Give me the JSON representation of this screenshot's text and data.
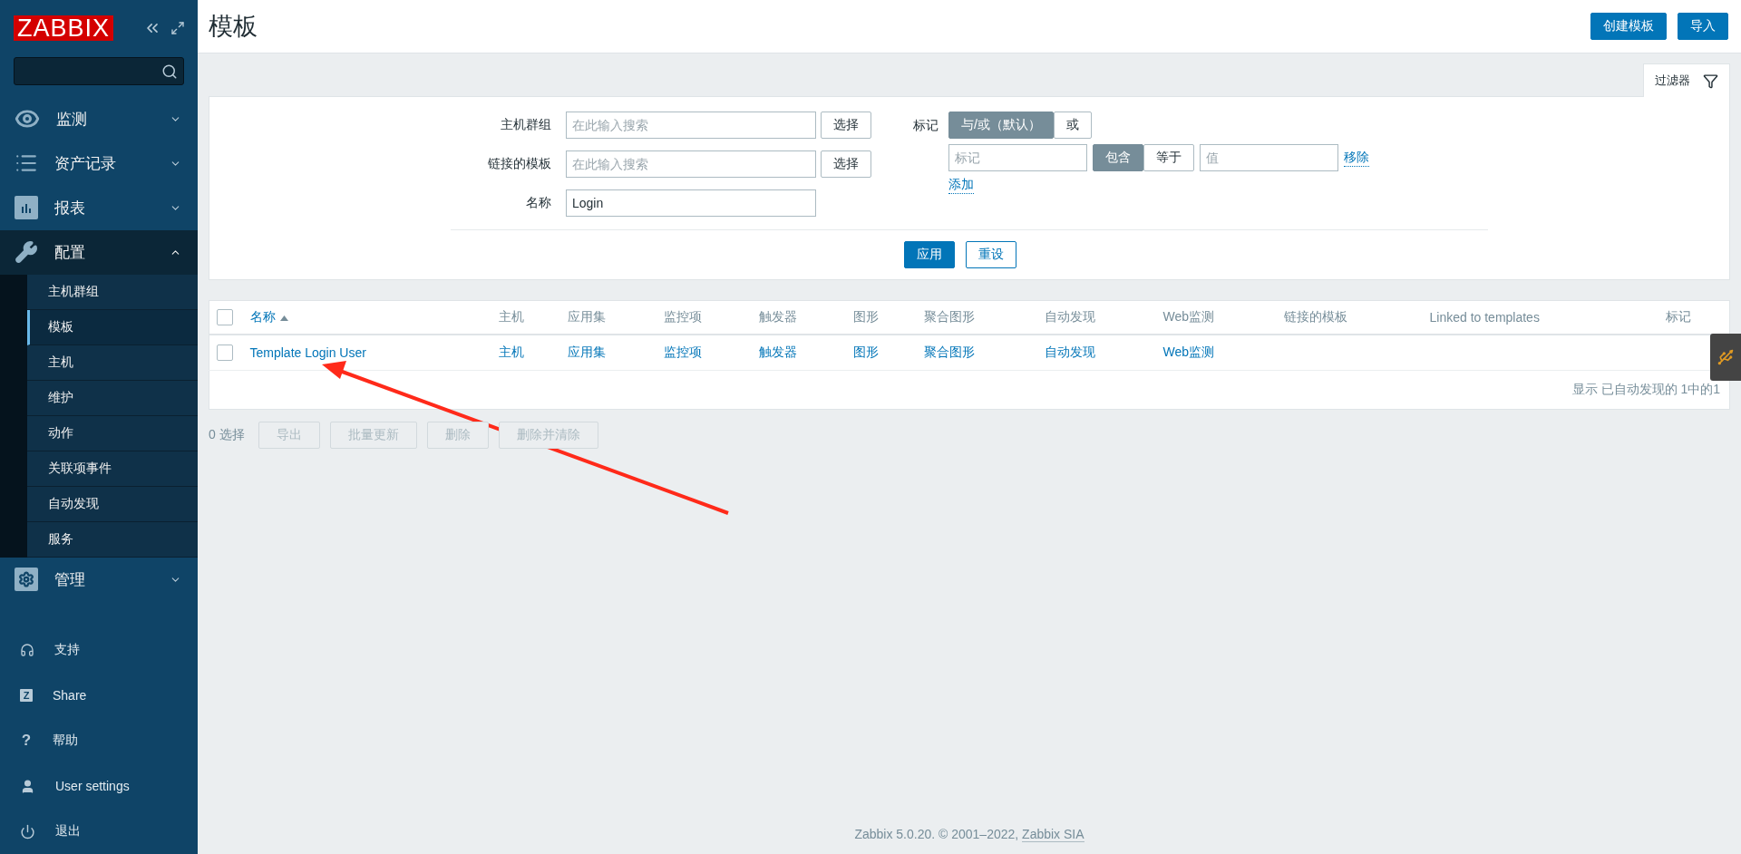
{
  "sidebar": {
    "logo": "ZABBIX",
    "menu": [
      {
        "label": "监测",
        "expanded": false
      },
      {
        "label": "资产记录",
        "expanded": false
      },
      {
        "label": "报表",
        "expanded": false
      },
      {
        "label": "配置",
        "expanded": true,
        "children": [
          {
            "label": "主机群组",
            "selected": false
          },
          {
            "label": "模板",
            "selected": true
          },
          {
            "label": "主机",
            "selected": false
          },
          {
            "label": "维护",
            "selected": false
          },
          {
            "label": "动作",
            "selected": false
          },
          {
            "label": "关联项事件",
            "selected": false
          },
          {
            "label": "自动发现",
            "selected": false
          },
          {
            "label": "服务",
            "selected": false
          }
        ]
      },
      {
        "label": "管理",
        "expanded": false
      }
    ],
    "links": [
      {
        "label": "支持"
      },
      {
        "label": "Share",
        "glyph": "Z"
      },
      {
        "label": "帮助",
        "glyph": "?"
      },
      {
        "label": "User settings"
      },
      {
        "label": "退出"
      }
    ]
  },
  "header": {
    "title": "模板",
    "buttons": [
      "创建模板",
      "导入"
    ]
  },
  "filter": {
    "tab": "过滤器",
    "fields": [
      {
        "label": "主机群组",
        "placeholder": "在此输入搜索",
        "button": "选择"
      },
      {
        "label": "链接的模板",
        "placeholder": "在此输入搜索",
        "button": "选择"
      },
      {
        "label": "名称",
        "value": "Login"
      }
    ],
    "tags": {
      "label": "标记",
      "operators": [
        {
          "label": "与/或（默认）",
          "selected": true
        },
        {
          "label": "或",
          "selected": false
        }
      ],
      "rows": [
        {
          "tag_placeholder": "标记",
          "match": [
            {
              "label": "包含",
              "selected": true
            },
            {
              "label": "等于",
              "selected": false
            }
          ],
          "value_placeholder": "值",
          "remove": "移除"
        }
      ],
      "add": "添加"
    },
    "apply": "应用",
    "reset": "重设"
  },
  "table": {
    "select_all": {
      "checked": false
    },
    "columns": [
      {
        "label": "名称",
        "sorted": true
      },
      {
        "label": "主机",
        "sorted": false
      },
      {
        "label": "应用集",
        "sorted": false
      },
      {
        "label": "监控项",
        "sorted": false
      },
      {
        "label": "触发器",
        "sorted": false
      },
      {
        "label": "图形",
        "sorted": false
      },
      {
        "label": "聚合图形",
        "sorted": false
      },
      {
        "label": "自动发现",
        "sorted": false
      },
      {
        "label": "Web监测",
        "sorted": false
      },
      {
        "label": "链接的模板",
        "sorted": false
      },
      {
        "label": "Linked to templates",
        "sorted": false
      },
      {
        "label": "标记",
        "sorted": false
      }
    ],
    "rows": [
      {
        "checked": false,
        "cells": [
          "Template Login User",
          "主机",
          "应用集",
          "监控项",
          "触发器",
          "图形",
          "聚合图形",
          "自动发现",
          "Web监测"
        ]
      }
    ],
    "summary": "显示 已自动发现的 1中的1"
  },
  "actions": {
    "count": "0 选择",
    "buttons": [
      {
        "label": "导出",
        "disabled": true
      },
      {
        "label": "批量更新",
        "disabled": true
      },
      {
        "label": "删除",
        "disabled": true
      },
      {
        "label": "删除并清除",
        "disabled": true
      }
    ]
  },
  "footer": {
    "text": "Zabbix 5.0.20. © 2001–2022, ",
    "link": "Zabbix SIA"
  }
}
